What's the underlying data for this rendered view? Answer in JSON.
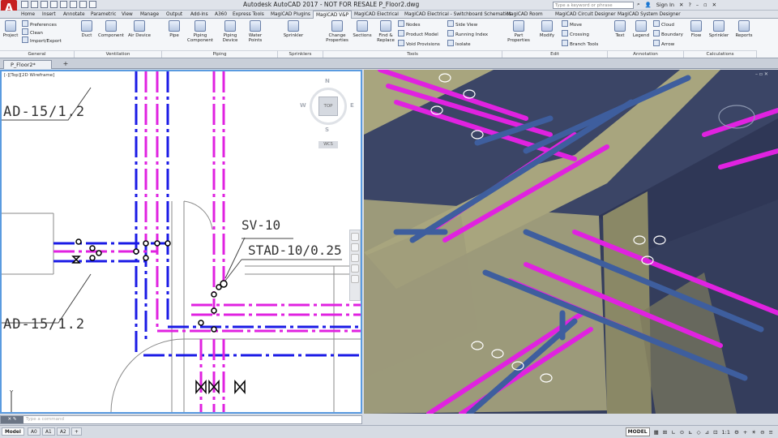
{
  "app": {
    "logo": "A",
    "window_title": "Autodesk AutoCAD 2017 - NOT FOR RESALE   P_Floor2.dwg",
    "search_placeholder": "Type a keyword or phrase",
    "sign_in": "Sign In",
    "help": "?"
  },
  "ribbon_tabs": [
    "Home",
    "Insert",
    "Annotate",
    "Parametric",
    "View",
    "Manage",
    "Output",
    "Add-ins",
    "A360",
    "Express Tools",
    "MagiCAD Plugins",
    "MagiCAD V&P",
    "MagiCAD Electrical",
    "MagiCAD Electrical - Switchboard Schematics",
    "MagiCAD Room",
    "MagiCAD Circuit Designer",
    "MagiCAD System Designer"
  ],
  "active_tab": "MagiCAD V&P",
  "ribbon": {
    "general": {
      "project": "Project",
      "preferences": "Preferences",
      "clean": "Clean",
      "import_export": "Import/Export",
      "panel": "General"
    },
    "ventilation": {
      "duct": "Duct",
      "component": "Component",
      "air_device": "Air Device",
      "panel": "Ventilation"
    },
    "piping": {
      "pipe": "Pipe",
      "piping_component": "Piping Component",
      "piping_device": "Piping Device",
      "water_points": "Water Points",
      "panel": "Piping"
    },
    "sprinklers": {
      "sprinkler": "Sprinkler",
      "panel": "Sprinklers"
    },
    "tools": {
      "change_properties": "Change Properties",
      "sections": "Sections",
      "find_replace": "Find & Replace",
      "nodes": "Nodes",
      "product_model": "Product Model",
      "void_provisions": "Void Provisions",
      "side_view": "Side View",
      "running_index": "Running Index",
      "isolate": "Isolate",
      "panel": "Tools"
    },
    "edit": {
      "part_properties": "Part Properties",
      "modify": "Modify",
      "move": "Move",
      "crossing": "Crossing",
      "branch_tools": "Branch Tools",
      "panel": "Edit"
    },
    "annotation": {
      "text": "Text",
      "legend": "Legend",
      "cloud": "Cloud",
      "boundary": "Boundary",
      "arrow": "Arrow",
      "panel": "Annotation"
    },
    "calculations": {
      "flow": "Flow",
      "sprinkler": "Sprinkler",
      "reports": "Reports",
      "panel": "Calculations"
    }
  },
  "file_tabs": {
    "active": "P_Floor2*",
    "new": "+"
  },
  "viewport_left": {
    "label": "[-][Top][2D Wireframe]",
    "annotations": {
      "ad_top": "AD-15/1.2",
      "ad_bottom": "AD-15/1.2",
      "sv": "SV-10",
      "stad": "STAD-10/0.25"
    },
    "viewcube": {
      "n": "N",
      "s": "S",
      "e": "E",
      "w": "W",
      "top": "TOP",
      "wcs": "WCS"
    },
    "ucs_y": "Y"
  },
  "viewport_right": {
    "controls": "– ▫ ✕"
  },
  "command": {
    "button": "✕ ✎",
    "placeholder": "Type a command"
  },
  "layout_tabs": [
    "Model",
    "A0",
    "A1",
    "A2"
  ],
  "status": {
    "model": "MODEL",
    "scale": "1:1",
    "items": [
      "▦",
      "⊞",
      "∟",
      "⊙",
      "⊾",
      "◇",
      "⊿",
      "⊡",
      "⚙",
      "+",
      "☀",
      "⊖",
      "≡"
    ]
  },
  "colors": {
    "magenta_pipe": "#e022e0",
    "blue_pipe": "#1a1ae6",
    "viewport_border": "#5a9be0",
    "model_bg": "#343d5c"
  }
}
